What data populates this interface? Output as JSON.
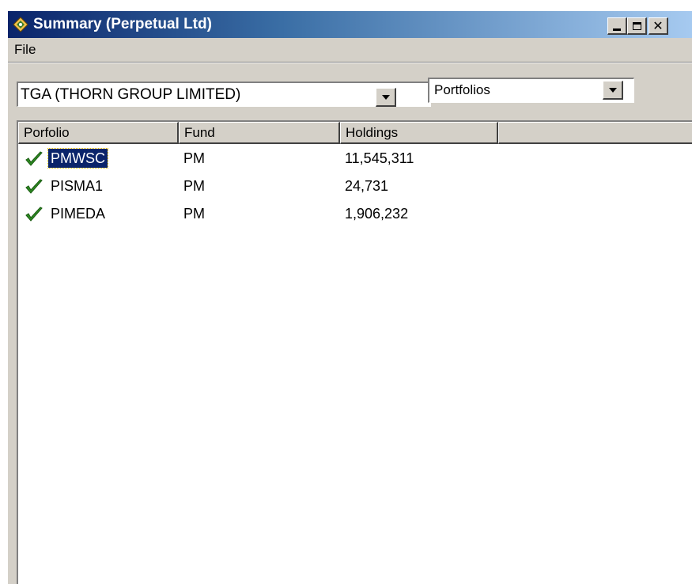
{
  "window": {
    "title": "Summary (Perpetual Ltd)",
    "icon": "app-icon",
    "controls": {
      "minimize": "minimize-icon",
      "maximize": "maximize-icon",
      "close": "✕"
    }
  },
  "menu": {
    "file": "File"
  },
  "filters": {
    "security": "TGA (THORN GROUP LIMITED)",
    "view": "Portfolios"
  },
  "table": {
    "columns": [
      "Porfolio",
      "Fund",
      "Holdings",
      ""
    ],
    "rows": [
      {
        "portfolio": "PMWSC",
        "fund": "PM",
        "holdings": "11,545,311",
        "selected": true,
        "status_icon": "check-icon"
      },
      {
        "portfolio": "PISMA1",
        "fund": "PM",
        "holdings": "24,731",
        "selected": false,
        "status_icon": "check-icon"
      },
      {
        "portfolio": "PIMEDA",
        "fund": "PM",
        "holdings": "1,906,232",
        "selected": false,
        "status_icon": "check-icon"
      }
    ]
  },
  "colors": {
    "title_start": "#0a246a",
    "title_end": "#a6caf0",
    "check": "#2e8b22",
    "selection": "#0a246a",
    "chrome": "#d4d0c8"
  }
}
